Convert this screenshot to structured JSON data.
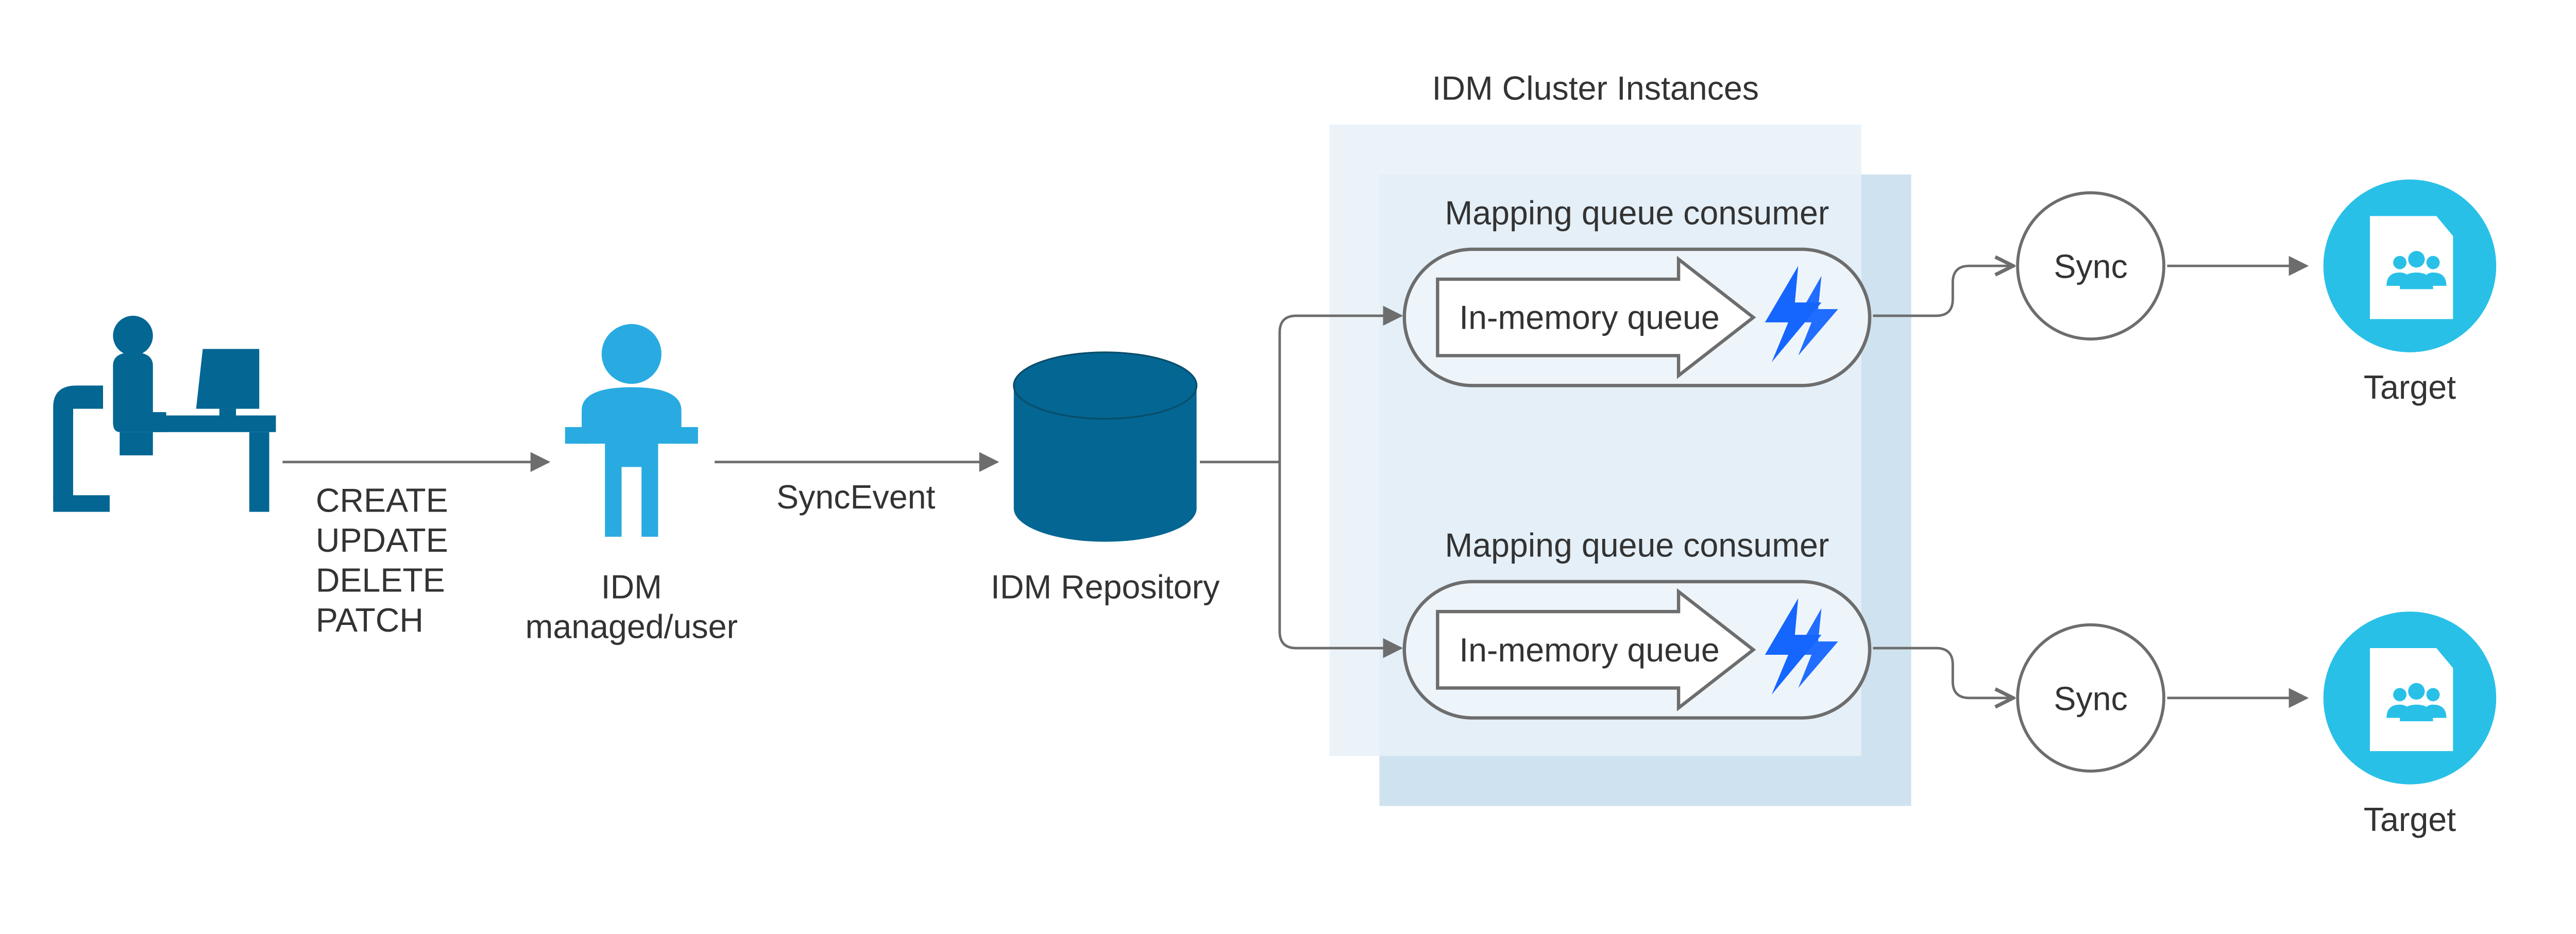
{
  "operations": {
    "l1": "CREATE",
    "l2": "UPDATE",
    "l3": "DELETE",
    "l4": "PATCH"
  },
  "idm_user_label_l1": "IDM",
  "idm_user_label_l2": "managed/user",
  "sync_event_label": "SyncEvent",
  "repository_label": "IDM Repository",
  "cluster_title": "IDM Cluster Instances",
  "consumers": {
    "top": {
      "title": "Mapping queue consumer",
      "queue_label": "In-memory queue",
      "sync_label": "Sync",
      "target_label": "Target"
    },
    "bottom": {
      "title": "Mapping queue consumer",
      "queue_label": "In-memory queue",
      "sync_label": "Sync",
      "target_label": "Target"
    }
  },
  "colors": {
    "dark_blue": "#036693",
    "mid_blue": "#29abe2",
    "light_blue_box": "#cfe2f0",
    "lighter_blue_box": "#e8f1f8",
    "pill_fill": "#eef5fa",
    "bolt_blue": "#1565ff",
    "grey_stroke": "#6d6d6d",
    "text": "#333333"
  }
}
